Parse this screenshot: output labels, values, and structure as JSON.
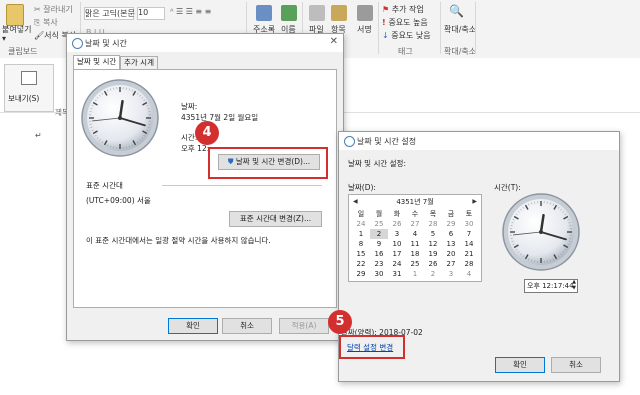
{
  "ribbon": {
    "paste": "붙여넣기",
    "cut": "잘라내기",
    "copy": "복사",
    "format_painter": "서식 복사",
    "clipboard_group": "클립보드",
    "font_name": "맑은 고딕(본문",
    "font_size": "10",
    "address_book": "주소록",
    "names": "이름",
    "file": "파일",
    "item": "항목",
    "signature": "서명",
    "follow_up": "추가 작업",
    "high_importance": "중요도 높음",
    "low_importance": "중요도 낮음",
    "tags_group": "태그",
    "zoom": "확대/축소",
    "zoom_group": "확대/축소"
  },
  "compose": {
    "send_label": "보내기(S)",
    "subject_prefix": "제목"
  },
  "date_time_dialog": {
    "title": "날짜 및 시간",
    "tabs": [
      "날짜 및 시간",
      "추가 시계"
    ],
    "date_label": "날짜:",
    "date_value": "4351년 7월 2일 월요일",
    "time_label": "시간:",
    "time_value": "오후 12:",
    "change_datetime_button": "날짜 및 시간 변경(D)...",
    "timezone_heading": "표준 시간대",
    "timezone_value": "(UTC+09:00) 서울",
    "change_timezone_button": "표준 시간대 변경(Z)...",
    "dst_note": "이 표준 시간대에서는 일광 절약 시간을 사용하지 않습니다.",
    "ok": "확인",
    "cancel": "취소",
    "apply": "적용(A)"
  },
  "settings_dialog": {
    "title": "날짜 및 시간 설정",
    "subtitle": "날짜 및 시간 설정:",
    "date_label": "날짜(D):",
    "time_label": "시간(T):",
    "calendar_month": "4351년 7월",
    "weekdays": [
      "일",
      "월",
      "화",
      "수",
      "목",
      "금",
      "토"
    ],
    "weeks": [
      [
        "24",
        "25",
        "26",
        "27",
        "28",
        "29",
        "30"
      ],
      [
        "1",
        "2",
        "3",
        "4",
        "5",
        "6",
        "7"
      ],
      [
        "8",
        "9",
        "10",
        "11",
        "12",
        "13",
        "14"
      ],
      [
        "15",
        "16",
        "17",
        "18",
        "19",
        "20",
        "21"
      ],
      [
        "22",
        "23",
        "24",
        "25",
        "26",
        "27",
        "28"
      ],
      [
        "29",
        "30",
        "31",
        "1",
        "2",
        "3",
        "4"
      ]
    ],
    "selected_day": "2",
    "time_value": "오후 12:17:44",
    "calendar_date_prefix": "달력",
    "calendar_date_text": "날짜(양력): 2018-07-02",
    "change_calendar_link": "달력 설정 변경",
    "ok": "확인",
    "cancel": "취소"
  },
  "annotations": {
    "step4": "4",
    "step5": "5",
    "color": "#d32f2f"
  },
  "clock": {
    "hours": 12,
    "minutes": 17,
    "seconds": 44
  }
}
